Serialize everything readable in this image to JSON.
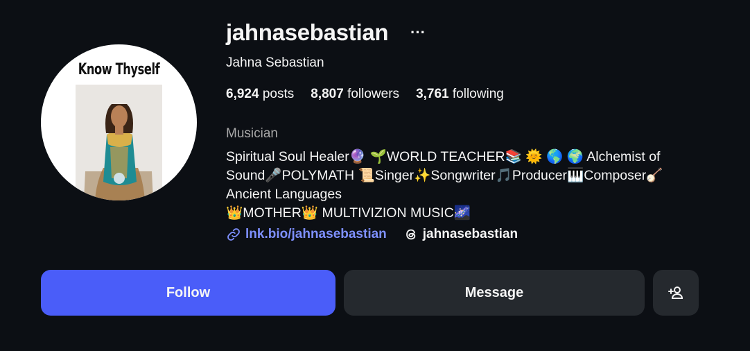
{
  "profile": {
    "username": "jahnasebastian",
    "full_name": "Jahna Sebastian",
    "avatar_text": "Know Thyself",
    "stats": {
      "posts_count": "6,924",
      "posts_label": "posts",
      "followers_count": "8,807",
      "followers_label": "followers",
      "following_count": "3,761",
      "following_label": "following"
    },
    "category": "Musician",
    "bio": "Spiritual Soul Healer🔮 🌱WORLD TEACHER📚 🌞 🌎 🌍 Alchemist of\nSound🎤POLYMATH 📜Singer✨Songwriter🎵Producer🎹Composer🪕\nAncient Languages\n👑MOTHER👑  MULTIVIZION MUSIC🌌",
    "link": "lnk.bio/jahnasebastian",
    "threads_handle": "jahnasebastian"
  },
  "actions": {
    "more_label": "···",
    "follow_label": "Follow",
    "message_label": "Message"
  },
  "icons": {
    "more": "more-dots-icon",
    "link": "link-icon",
    "threads": "threads-icon",
    "add_person": "add-person-icon"
  },
  "colors": {
    "background": "#0c0f14",
    "follow": "#4a5df9",
    "secondary_button": "#25292e",
    "link": "#7e90ff",
    "muted": "#a8a8a8"
  }
}
